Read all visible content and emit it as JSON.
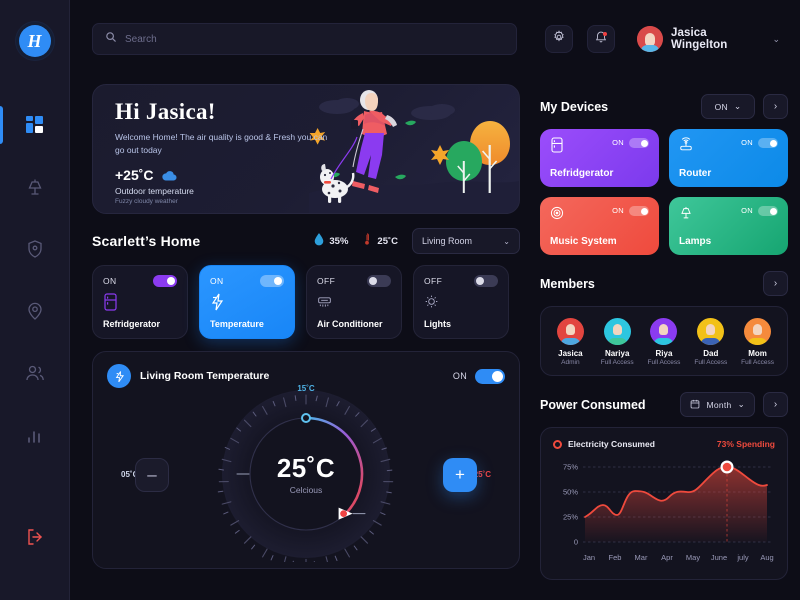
{
  "brand": {
    "logo_letter": "H"
  },
  "header": {
    "search": {
      "placeholder": "Search",
      "value": ""
    },
    "settings_icon": "gear-icon",
    "notifications_icon": "bell-icon",
    "user": {
      "name": "Jasica Wingelton",
      "chevron": "⌄"
    }
  },
  "sidebar": {
    "items": [
      {
        "name": "dashboard",
        "icon": "dashboard-grid-icon",
        "active": true
      },
      {
        "name": "devices",
        "icon": "lamp-icon",
        "active": false
      },
      {
        "name": "security",
        "icon": "shield-icon",
        "active": false
      },
      {
        "name": "location",
        "icon": "location-pin-icon",
        "active": false
      },
      {
        "name": "members",
        "icon": "people-icon",
        "active": false
      },
      {
        "name": "statistics",
        "icon": "bar-chart-icon",
        "active": false
      }
    ],
    "logout": {
      "name": "logout",
      "icon": "logout-icon"
    }
  },
  "hero": {
    "greeting": "Hi Jasica!",
    "subtitle": "Welcome Home! The air quality is good & Fresh you can go out today",
    "temperature": "+25˚C",
    "weather_icon": "cloud-icon",
    "temp_label": "Outdoor temperature",
    "weather_desc": "Fuzzy cloudy weather"
  },
  "home": {
    "title": "Scarlett’s Home",
    "humidity": {
      "icon": "water-drop-icon",
      "value": "35%"
    },
    "temperature": {
      "icon": "thermometer-icon",
      "value": "25˚C"
    },
    "room_select": {
      "value": "Living Room",
      "chevron": "⌄"
    },
    "tiles": [
      {
        "state": "ON",
        "name": "Refridgerator",
        "icon": "fridge-icon",
        "on": true,
        "active": false
      },
      {
        "state": "ON",
        "name": "Temperature",
        "icon": "bolt-icon",
        "on": true,
        "active": true
      },
      {
        "state": "OFF",
        "name": "Air Conditioner",
        "icon": "ac-icon",
        "on": false,
        "active": false
      },
      {
        "state": "OFF",
        "name": "Lights",
        "icon": "bulb-icon",
        "on": false,
        "active": false
      }
    ]
  },
  "thermostat": {
    "icon": "bolt-icon",
    "title": "Living Room Temperature",
    "state_label": "ON",
    "on": true,
    "value": "25˚C",
    "unit": "Celcious",
    "label_top": "15˚C",
    "label_left": "05˚C",
    "label_right": "25˚C",
    "decrease": "–",
    "increase": "+",
    "accent_cold": "#4fb4e8",
    "accent_hot": "#ef4444"
  },
  "devices": {
    "title": "My Devices",
    "filter": {
      "value": "ON",
      "chevron": "⌄"
    },
    "more": "›",
    "items": [
      {
        "name": "Refridgerator",
        "state": "ON",
        "icon": "fridge-icon",
        "color_from": "#9b4dfb",
        "color_to": "#7c3aed"
      },
      {
        "name": "Router",
        "state": "ON",
        "icon": "router-icon",
        "color_from": "#2196f3",
        "color_to": "#0c8ae8"
      },
      {
        "name": "Music System",
        "state": "ON",
        "icon": "vinyl-icon",
        "color_from": "#f4685c",
        "color_to": "#ef4a3d"
      },
      {
        "name": "Lamps",
        "state": "ON",
        "icon": "lamp-icon",
        "color_from": "#3fc79a",
        "color_to": "#16a571"
      }
    ]
  },
  "members": {
    "title": "Members",
    "more": "›",
    "items": [
      {
        "name": "Jasica",
        "role": "Admin",
        "color": "#e2453f",
        "body": "#4ea7e0"
      },
      {
        "name": "Nariya",
        "role": "Full Access",
        "color": "#2dc6e0",
        "body": "#3fc79a"
      },
      {
        "name": "Riya",
        "role": "Full Access",
        "color": "#8b3bf0",
        "body": "#2dc6e0"
      },
      {
        "name": "Dad",
        "role": "Full Access",
        "color": "#f2c118",
        "body": "#3b63b5"
      },
      {
        "name": "Mom",
        "role": "Full Access",
        "color": "#f58a3c",
        "body": "#f2c118"
      }
    ]
  },
  "power": {
    "title": "Power Consumed",
    "period": {
      "icon": "calendar-icon",
      "value": "Month",
      "chevron": "⌄"
    },
    "more": "›"
  },
  "chart_data": {
    "type": "area",
    "title": "Electricity Consumed",
    "annotation": "73% Spending",
    "legend": [
      "Electricity Consumed"
    ],
    "legend_position": "top-left",
    "grid": true,
    "categories": [
      "Jan",
      "Feb",
      "Mar",
      "Apr",
      "May",
      "June",
      "july",
      "Aug"
    ],
    "x": [
      "Jan",
      "Feb",
      "Mar",
      "Apr",
      "May",
      "June",
      "july",
      "Aug"
    ],
    "values": [
      25,
      29,
      52,
      45,
      51,
      58,
      73,
      62
    ],
    "series": [
      {
        "name": "Electricity Consumed",
        "values": [
          25,
          29,
          52,
          45,
          51,
          58,
          73,
          62
        ]
      }
    ],
    "highlight": {
      "category": "july",
      "value": 73
    },
    "xlabel": "",
    "ylabel": "",
    "ylim": [
      0,
      85
    ],
    "yticks": [
      0,
      25,
      50,
      75
    ],
    "ytick_labels": [
      "0",
      "25%",
      "50%",
      "75%"
    ],
    "line_color": "#ef4a3d",
    "fill_color": "#ef4a3d"
  }
}
